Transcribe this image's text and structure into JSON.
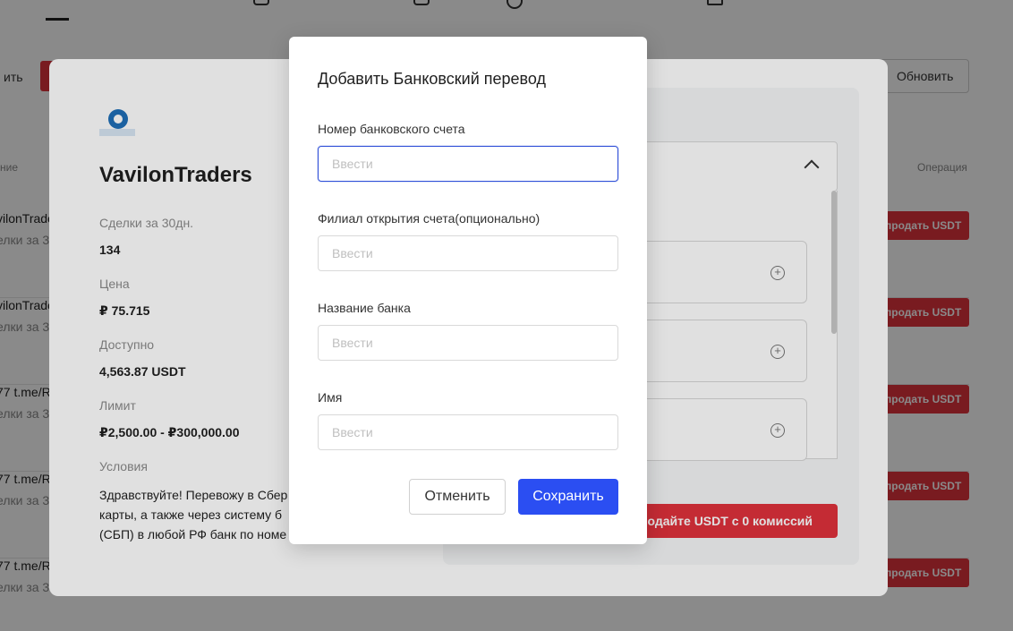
{
  "background": {
    "left_button_label": "ить",
    "refresh_button_label": "Обновить",
    "column_left_header": "ние",
    "column_right_header": "Операция",
    "rows": [
      {
        "name": "vilonTrade",
        "sub": "елки за 3",
        "action": "продать USDT"
      },
      {
        "name": "vilonTrade",
        "sub": "елки за 3",
        "action": "продать USDT"
      },
      {
        "name": "77 t.me/R",
        "sub": "елки за 3",
        "action": "продать USDT"
      },
      {
        "name": "77 t.me/R",
        "sub": "елки за 3",
        "action": "продать USDT"
      },
      {
        "name": "77 t.me/R",
        "sub": "елки за 3",
        "action": "продать USDT"
      }
    ]
  },
  "merchant": {
    "name": "VavilonTraders",
    "trades_label": "Сделки за 30дн.",
    "trades_value": "134",
    "price_label": "Цена",
    "price_value": "₽ 75.715",
    "available_label": "Доступно",
    "available_value": "4,563.87 USDT",
    "limit_label": "Лимит",
    "limit_value": "₽2,500.00 - ₽300,000.00",
    "terms_label": "Условия",
    "terms_lines": [
      "Здравствуйте! Перевожу в Сбер",
      "карты, а также через систему б",
      "(СБП) в любой РФ банк по номе"
    ],
    "promo_button": "родайте USDT с 0 комиссий"
  },
  "modal": {
    "title": "Добавить Банковский перевод",
    "fields": [
      {
        "label": "Номер банковского счета",
        "placeholder": "Ввести",
        "value": ""
      },
      {
        "label": "Филиал открытия счета(опционально)",
        "placeholder": "Ввести",
        "value": ""
      },
      {
        "label": "Название банка",
        "placeholder": "Ввести",
        "value": ""
      },
      {
        "label": "Имя",
        "placeholder": "Ввести",
        "value": ""
      }
    ],
    "cancel_label": "Отменить",
    "save_label": "Сохранить"
  },
  "colors": {
    "primary": "#2b4ef2",
    "danger": "#e0323c",
    "focus_border": "#3050d8"
  }
}
